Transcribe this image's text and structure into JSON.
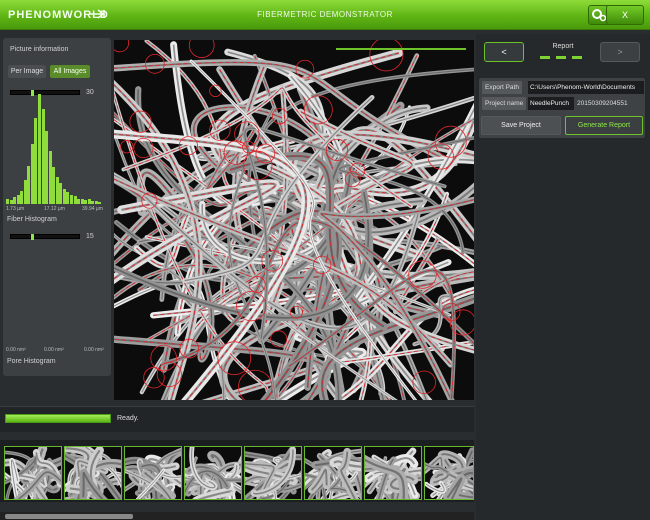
{
  "app": {
    "logo_text": "PHENOMWORLD",
    "title": "FIBERMETRIC DEMONSTRATOR",
    "close_label": "X"
  },
  "left_panel": {
    "section_title": "Picture information",
    "tabs": [
      {
        "label": "Per Image",
        "active": false
      },
      {
        "label": "All Images",
        "active": true
      }
    ],
    "fiber_slider_value": "30",
    "fiber_histogram": {
      "x_min": "1.73 µm",
      "x_mid": "17.12 µm",
      "x_max": "39.94 µm",
      "label": "Fiber Histogram",
      "bar_heights": [
        0.05,
        0.04,
        0.06,
        0.08,
        0.12,
        0.22,
        0.35,
        0.55,
        0.78,
        1.0,
        0.86,
        0.66,
        0.48,
        0.34,
        0.25,
        0.19,
        0.14,
        0.11,
        0.08,
        0.07,
        0.05,
        0.05,
        0.04,
        0.05,
        0.03,
        0.03,
        0.02
      ]
    },
    "pore_slider_value": "15",
    "pore_histogram": {
      "x_min": "0.00 nm²",
      "x_mid": "0.00 nm²",
      "x_max": "0.00 nm²",
      "label": "Pore Histogram"
    }
  },
  "report": {
    "prev_label": "<",
    "next_label": ">",
    "title": "Report",
    "export_path_label": "Export Path",
    "export_path_value": "C:\\Users\\Phenom-World\\Documents",
    "project_name_label": "Project name",
    "project_name_value": "NeedlePunch",
    "project_id": "20150309204551",
    "save_label": "Save Project",
    "generate_label": "Generate Report"
  },
  "status": {
    "text": "Ready.",
    "progress": 1.0
  },
  "thumbnails_count": 8,
  "colors": {
    "accent": "#6ec32a",
    "title_bar": "#5fb514",
    "annotation": "#e0262b"
  }
}
